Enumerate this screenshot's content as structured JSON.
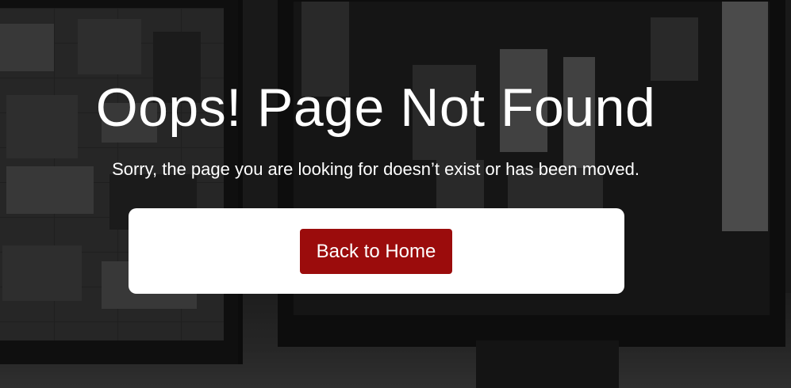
{
  "page": {
    "title": "Oops! Page Not Found",
    "message": "Sorry, the page you are looking for doesn’t exist or has been moved."
  },
  "actions": {
    "home_label": "Back to Home"
  },
  "colors": {
    "button_background": "#9b0c0c",
    "card_background": "#ffffff",
    "text": "#ffffff"
  }
}
